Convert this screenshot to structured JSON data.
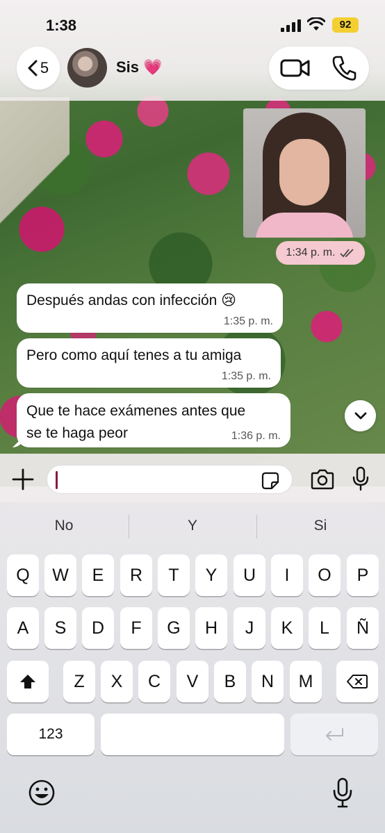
{
  "status_bar": {
    "time": "1:38",
    "battery": "92"
  },
  "header": {
    "back_count": "5",
    "contact_name": "Sis 💗"
  },
  "messages": [
    {
      "type": "image",
      "from": "me",
      "time": "1:34 p. m.",
      "read": true
    },
    {
      "type": "text",
      "from": "them",
      "text": "Después andas con infección 😢",
      "time": "1:35 p. m."
    },
    {
      "type": "text",
      "from": "them",
      "text": "Pero como aquí tenes a tu amiga",
      "time": "1:35 p. m."
    },
    {
      "type": "text",
      "from": "them",
      "text_line1": "Que te hace exámenes antes que",
      "text_line2": "se te haga peor",
      "time": "1:36 p. m."
    }
  ],
  "input": {
    "value": "",
    "placeholder": ""
  },
  "keyboard": {
    "suggestions": [
      "No",
      "Y",
      "Si"
    ],
    "row1": [
      "Q",
      "W",
      "E",
      "R",
      "T",
      "Y",
      "U",
      "I",
      "O",
      "P"
    ],
    "row2": [
      "A",
      "S",
      "D",
      "F",
      "G",
      "H",
      "J",
      "K",
      "L",
      "Ñ"
    ],
    "row3": [
      "Z",
      "X",
      "C",
      "V",
      "B",
      "N",
      "M"
    ],
    "numbers_key": "123"
  },
  "colors": {
    "accent_sent_pill": "#f5c9d0",
    "battery": "#f5cf32",
    "cursor": "#8b1a3a"
  }
}
